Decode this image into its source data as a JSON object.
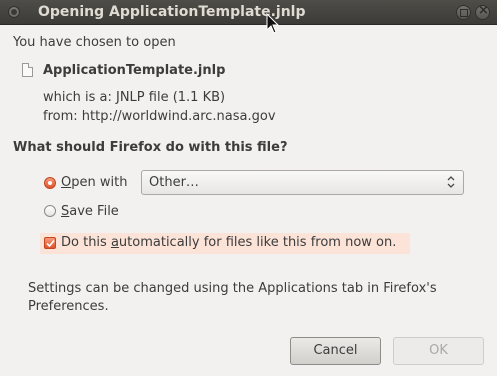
{
  "window": {
    "title": "Opening ApplicationTemplate.jnlp"
  },
  "dialog": {
    "intro": "You have chosen to open",
    "filename": "ApplicationTemplate.jnlp",
    "type_line": "which is a:  JNLP file (1.1 KB)",
    "from_line": "from:  http://worldwind.arc.nasa.gov",
    "question": "What should Firefox do with this file?",
    "open_with": {
      "label_accel": "O",
      "label_rest": "pen with",
      "checked": true
    },
    "application_select": {
      "value": "Other…"
    },
    "save_file": {
      "label_accel": "S",
      "label_rest": "ave File",
      "checked": false
    },
    "auto": {
      "label_before": "Do this ",
      "label_accel": "a",
      "label_after": "utomatically for files like this from now on.",
      "checked": true
    },
    "settings_line1": "Settings can be changed using the Applications tab in Firefox's",
    "settings_line2": "Preferences."
  },
  "buttons": {
    "cancel": "Cancel",
    "ok": "OK"
  },
  "colors": {
    "titlebar": "#3c3b37",
    "accent": "#e0532a",
    "highlight_row": "#fbe3d8",
    "background": "#f2f1f0"
  }
}
